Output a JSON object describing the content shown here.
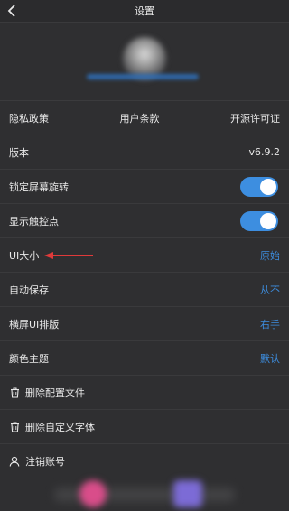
{
  "topbar": {
    "title": "设置"
  },
  "links": {
    "privacy": "隐私政策",
    "terms": "用户条款",
    "license": "开源许可证"
  },
  "rows": {
    "version": {
      "label": "版本",
      "value": "v6.9.2"
    },
    "lock_rotation": {
      "label": "锁定屏幕旋转",
      "enabled": true
    },
    "show_touch": {
      "label": "显示触控点",
      "enabled": true
    },
    "ui_size": {
      "label": "UI大小",
      "value": "原始"
    },
    "autosave": {
      "label": "自动保存",
      "value": "从不"
    },
    "landscape_layout": {
      "label": "横屏UI排版",
      "value": "右手"
    },
    "color_theme": {
      "label": "颜色主题",
      "value": "默认"
    },
    "delete_config": {
      "label": "删除配置文件"
    },
    "delete_font": {
      "label": "删除自定义字体"
    },
    "logout": {
      "label": "注销账号"
    }
  },
  "colors": {
    "accent": "#3d8ee0",
    "annotation_arrow": "#e03a3a",
    "background": "#2f2f31"
  },
  "icons": {
    "back": "chevron-left-icon",
    "trash": "trash-icon",
    "user": "user-icon"
  }
}
